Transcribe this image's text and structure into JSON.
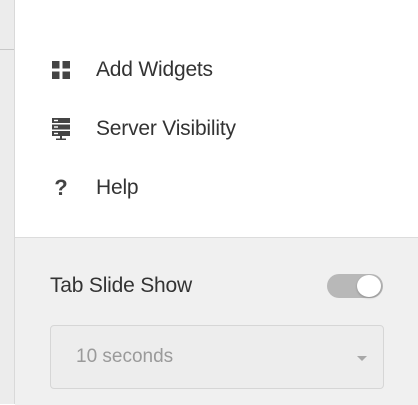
{
  "menu": {
    "items": [
      {
        "label": "Add Widgets",
        "icon": "grid-icon"
      },
      {
        "label": "Server Visibility",
        "icon": "server-icon"
      },
      {
        "label": "Help",
        "icon": "help-icon",
        "glyph": "?"
      }
    ]
  },
  "settings": {
    "slideshow_label": "Tab Slide Show",
    "slideshow_enabled": true,
    "interval_value": "10 seconds",
    "interval_disabled": true
  },
  "colors": {
    "text": "#333333",
    "icon": "#444444",
    "settings_bg": "#f0f0f0",
    "toggle_track": "#b8b8b8",
    "select_text_disabled": "#9a9a9a"
  }
}
